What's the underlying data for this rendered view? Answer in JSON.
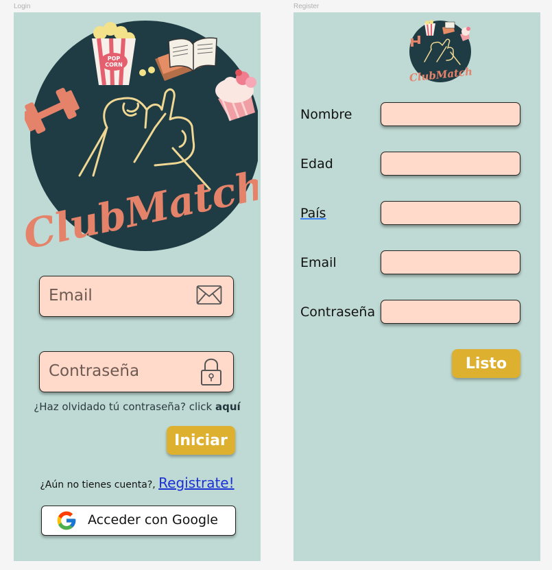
{
  "frames": {
    "login_title": "Login",
    "register_title": "Register"
  },
  "logo": {
    "text": "ClubMatch",
    "popcorn_text": "POP CORN"
  },
  "login": {
    "email_placeholder": "Email",
    "password_placeholder": "Contraseña",
    "forgot_text": "¿Haz olvidado tú contraseña? click ",
    "forgot_link": "aquí",
    "login_button": "Iniciar",
    "signup_text": "¿Aún no tienes cuenta?, ",
    "signup_link": "Registrate!",
    "google_button": "Acceder con Google"
  },
  "register": {
    "fields": [
      {
        "label": "Nombre",
        "value": ""
      },
      {
        "label": "Edad",
        "value": ""
      },
      {
        "label": "País",
        "value": ""
      },
      {
        "label": "Email",
        "value": ""
      },
      {
        "label": "Contraseña",
        "value": ""
      }
    ],
    "done_button": "Listo"
  },
  "colors": {
    "background": "#bfdad4",
    "logo_circle": "#1f3c45",
    "logo_text": "#e5826a",
    "input_fill": "#ffd9c9",
    "accent_button": "#deb030",
    "link": "#1a2fd6"
  },
  "icons": [
    "mail-icon",
    "lock-icon",
    "google-logo-icon",
    "popcorn-icon",
    "book-icon",
    "cupcake-icon",
    "dumbbell-icon",
    "pinky-promise-icon"
  ]
}
